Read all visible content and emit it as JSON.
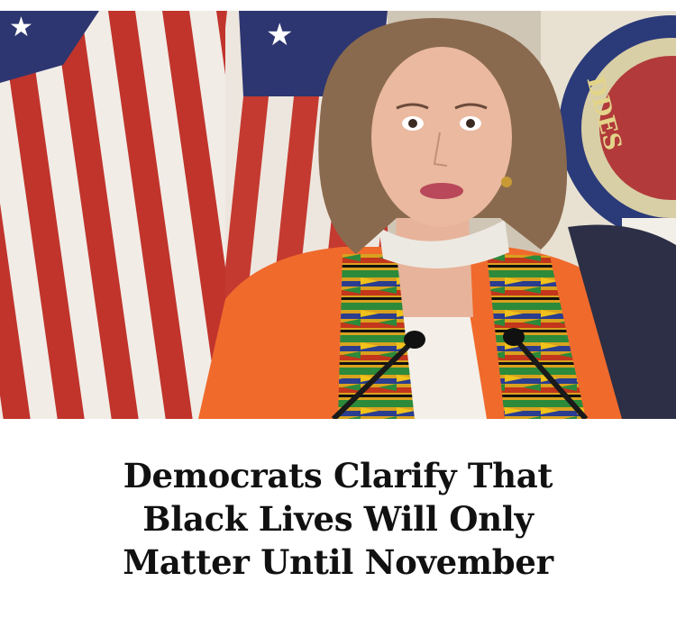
{
  "headline": {
    "lines": [
      "Democrats Clarify That",
      "Black Lives Will Only",
      "Matter Until November"
    ]
  },
  "photo": {
    "seal_letters": "DDES"
  },
  "colors": {
    "flag_red": "#c0342c",
    "flag_white": "#f1ece6",
    "flag_blue": "#2d3670",
    "jacket": "#f06a2c",
    "text": "#111111"
  }
}
